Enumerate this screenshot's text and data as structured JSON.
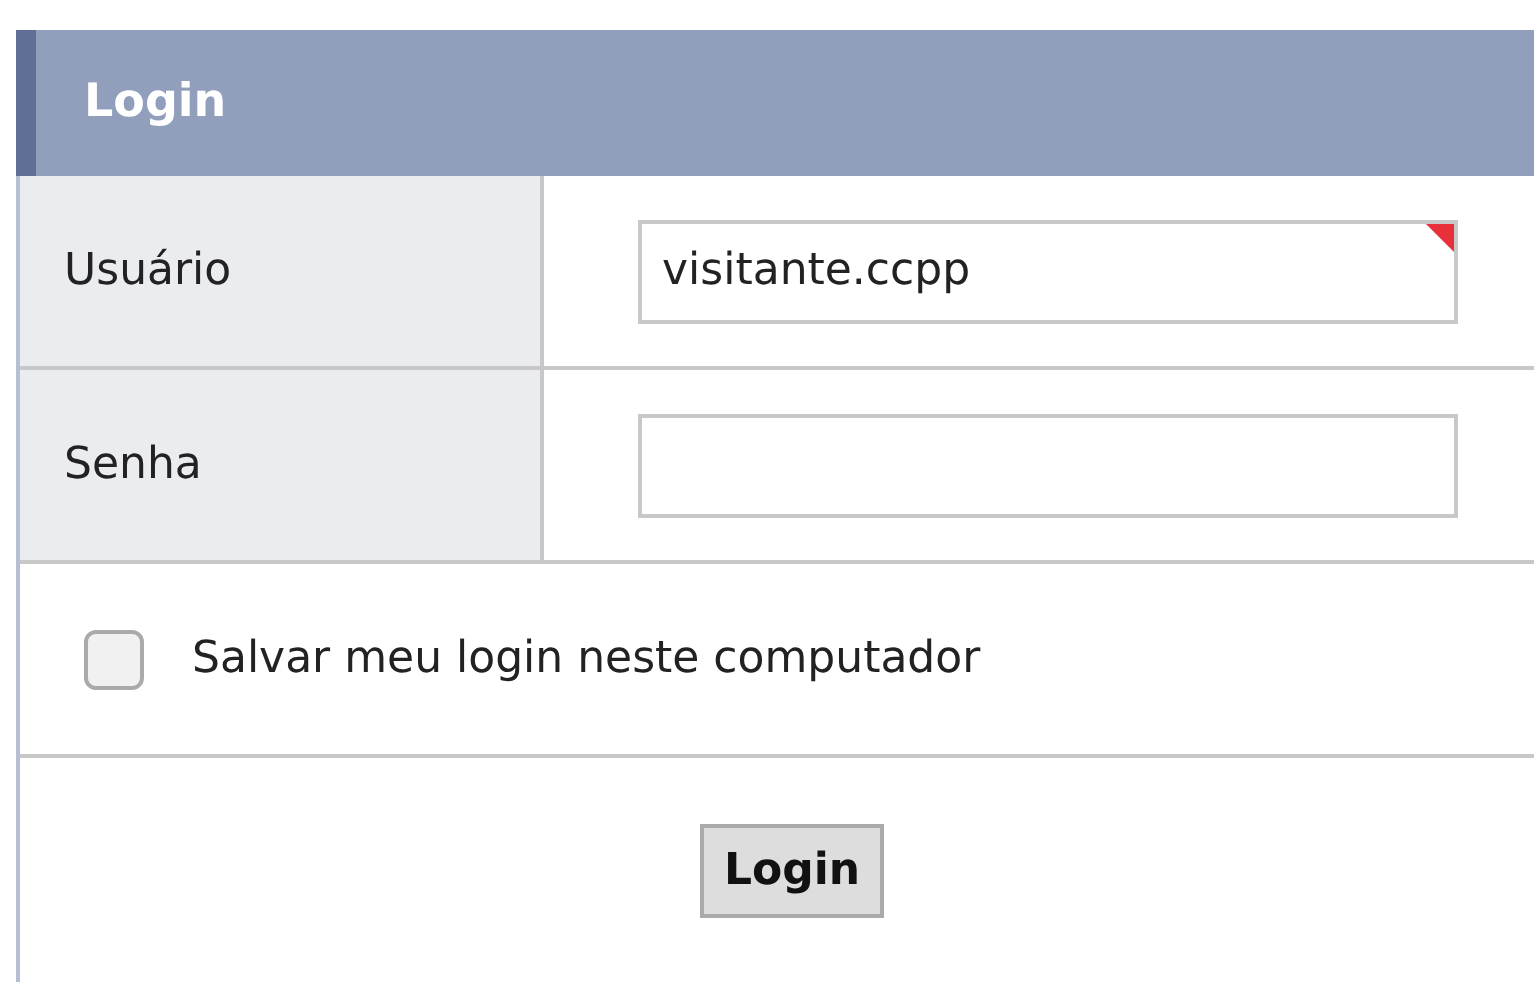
{
  "panel": {
    "title": "Login"
  },
  "fields": [
    {
      "label": "Usuário",
      "value": "visitante.ccpp",
      "required": true
    },
    {
      "label": "Senha",
      "required": false
    }
  ],
  "remember": {
    "label": "Salvar meu login neste computador",
    "checked": false
  },
  "buttons": [
    "Login"
  ]
}
